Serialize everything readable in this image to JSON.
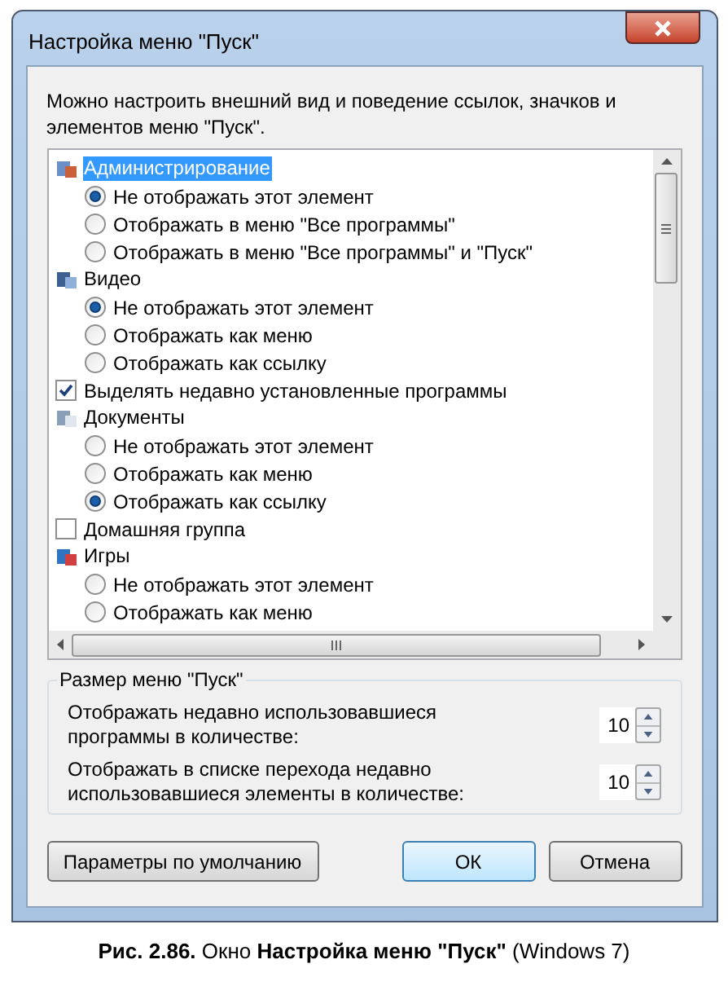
{
  "window": {
    "title": "Настройка меню \"Пуск\""
  },
  "description": "Можно настроить внешний вид и поведение ссылок, значков и элементов меню \"Пуск\".",
  "options": [
    {
      "kind": "group",
      "label": "Администрирование",
      "selected": true,
      "children": [
        {
          "label": "Не отображать этот элемент",
          "selected": true
        },
        {
          "label": "Отображать в меню \"Все программы\"",
          "selected": false
        },
        {
          "label": "Отображать в меню \"Все программы\" и \"Пуск\"",
          "selected": false
        }
      ]
    },
    {
      "kind": "group",
      "label": "Видео",
      "selected": false,
      "children": [
        {
          "label": "Не отображать этот элемент",
          "selected": true
        },
        {
          "label": "Отображать как меню",
          "selected": false
        },
        {
          "label": "Отображать как ссылку",
          "selected": false
        }
      ]
    },
    {
      "kind": "checkbox",
      "label": "Выделять недавно установленные программы",
      "checked": true
    },
    {
      "kind": "group",
      "label": "Документы",
      "selected": false,
      "children": [
        {
          "label": "Не отображать этот элемент",
          "selected": false
        },
        {
          "label": "Отображать как меню",
          "selected": false
        },
        {
          "label": "Отображать как ссылку",
          "selected": true
        }
      ]
    },
    {
      "kind": "checkbox",
      "label": "Домашняя группа",
      "checked": false
    },
    {
      "kind": "group",
      "label": "Игры",
      "selected": false,
      "children": [
        {
          "label": "Не отображать этот элемент",
          "selected": false
        },
        {
          "label": "Отображать как меню",
          "selected": false
        }
      ]
    }
  ],
  "size_group": {
    "title": "Размер меню \"Пуск\"",
    "rows": [
      {
        "label": "Отображать недавно использовавшиеся программы в количестве:",
        "value": "10"
      },
      {
        "label": "Отображать в списке перехода недавно использовавшиеся элементы в количестве:",
        "value": "10"
      }
    ]
  },
  "buttons": {
    "defaults": "Параметры по умолчанию",
    "ok": "ОК",
    "cancel": "Отмена"
  },
  "caption": "**Рис. 2.86.** Окно **Настройка меню \"Пуск\"** (Windows 7)"
}
